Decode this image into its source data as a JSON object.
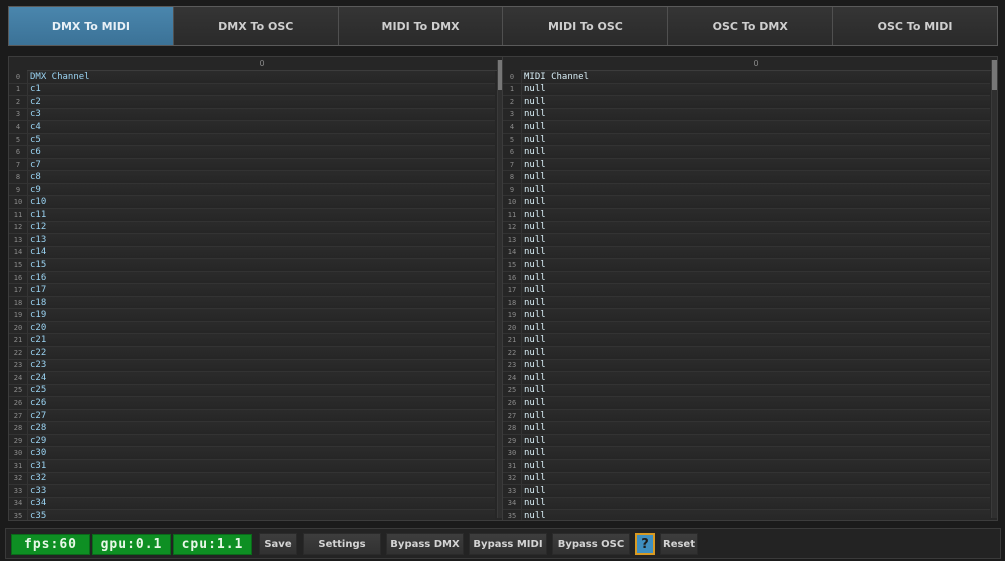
{
  "tabs": [
    {
      "label": "DMX To MIDI",
      "active": true
    },
    {
      "label": "DMX To OSC",
      "active": false
    },
    {
      "label": "MIDI To DMX",
      "active": false
    },
    {
      "label": "MIDI To OSC",
      "active": false
    },
    {
      "label": "OSC To DMX",
      "active": false
    },
    {
      "label": "OSC To MIDI",
      "active": false
    }
  ],
  "left_table": {
    "column_header": "0",
    "rows": [
      {
        "num": "0",
        "value": "DMX Channel"
      },
      {
        "num": "1",
        "value": "c1"
      },
      {
        "num": "2",
        "value": "c2"
      },
      {
        "num": "3",
        "value": "c3"
      },
      {
        "num": "4",
        "value": "c4"
      },
      {
        "num": "5",
        "value": "c5"
      },
      {
        "num": "6",
        "value": "c6"
      },
      {
        "num": "7",
        "value": "c7"
      },
      {
        "num": "8",
        "value": "c8"
      },
      {
        "num": "9",
        "value": "c9"
      },
      {
        "num": "10",
        "value": "c10"
      },
      {
        "num": "11",
        "value": "c11"
      },
      {
        "num": "12",
        "value": "c12"
      },
      {
        "num": "13",
        "value": "c13"
      },
      {
        "num": "14",
        "value": "c14"
      },
      {
        "num": "15",
        "value": "c15"
      },
      {
        "num": "16",
        "value": "c16"
      },
      {
        "num": "17",
        "value": "c17"
      },
      {
        "num": "18",
        "value": "c18"
      },
      {
        "num": "19",
        "value": "c19"
      },
      {
        "num": "20",
        "value": "c20"
      },
      {
        "num": "21",
        "value": "c21"
      },
      {
        "num": "22",
        "value": "c22"
      },
      {
        "num": "23",
        "value": "c23"
      },
      {
        "num": "24",
        "value": "c24"
      },
      {
        "num": "25",
        "value": "c25"
      },
      {
        "num": "26",
        "value": "c26"
      },
      {
        "num": "27",
        "value": "c27"
      },
      {
        "num": "28",
        "value": "c28"
      },
      {
        "num": "29",
        "value": "c29"
      },
      {
        "num": "30",
        "value": "c30"
      },
      {
        "num": "31",
        "value": "c31"
      },
      {
        "num": "32",
        "value": "c32"
      },
      {
        "num": "33",
        "value": "c33"
      },
      {
        "num": "34",
        "value": "c34"
      },
      {
        "num": "35",
        "value": "c35"
      }
    ]
  },
  "right_table": {
    "column_header": "0",
    "rows": [
      {
        "num": "0",
        "value": "MIDI Channel"
      },
      {
        "num": "1",
        "value": "null"
      },
      {
        "num": "2",
        "value": "null"
      },
      {
        "num": "3",
        "value": "null"
      },
      {
        "num": "4",
        "value": "null"
      },
      {
        "num": "5",
        "value": "null"
      },
      {
        "num": "6",
        "value": "null"
      },
      {
        "num": "7",
        "value": "null"
      },
      {
        "num": "8",
        "value": "null"
      },
      {
        "num": "9",
        "value": "null"
      },
      {
        "num": "10",
        "value": "null"
      },
      {
        "num": "11",
        "value": "null"
      },
      {
        "num": "12",
        "value": "null"
      },
      {
        "num": "13",
        "value": "null"
      },
      {
        "num": "14",
        "value": "null"
      },
      {
        "num": "15",
        "value": "null"
      },
      {
        "num": "16",
        "value": "null"
      },
      {
        "num": "17",
        "value": "null"
      },
      {
        "num": "18",
        "value": "null"
      },
      {
        "num": "19",
        "value": "null"
      },
      {
        "num": "20",
        "value": "null"
      },
      {
        "num": "21",
        "value": "null"
      },
      {
        "num": "22",
        "value": "null"
      },
      {
        "num": "23",
        "value": "null"
      },
      {
        "num": "24",
        "value": "null"
      },
      {
        "num": "25",
        "value": "null"
      },
      {
        "num": "26",
        "value": "null"
      },
      {
        "num": "27",
        "value": "null"
      },
      {
        "num": "28",
        "value": "null"
      },
      {
        "num": "29",
        "value": "null"
      },
      {
        "num": "30",
        "value": "null"
      },
      {
        "num": "31",
        "value": "null"
      },
      {
        "num": "32",
        "value": "null"
      },
      {
        "num": "33",
        "value": "null"
      },
      {
        "num": "34",
        "value": "null"
      },
      {
        "num": "35",
        "value": "null"
      }
    ]
  },
  "status": {
    "fps": "fps:60",
    "gpu": "gpu:0.1",
    "cpu": "cpu:1.1"
  },
  "toolbar": {
    "save": "Save",
    "settings": "Settings",
    "bypass_dmx": "Bypass DMX",
    "bypass_midi": "Bypass MIDI",
    "bypass_osc": "Bypass OSC",
    "help": "?",
    "reset": "Reset"
  },
  "colors": {
    "accent": "#3b7297",
    "stat_bg": "#0e8f23",
    "help_border": "#d99a22"
  }
}
